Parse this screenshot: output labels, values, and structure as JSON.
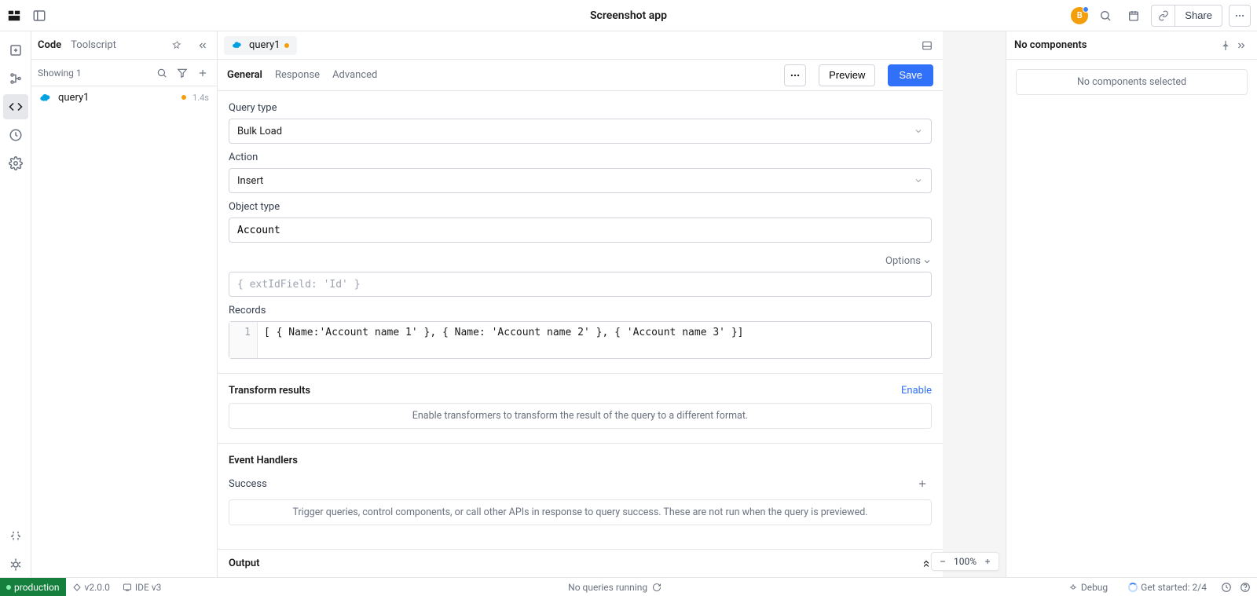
{
  "header": {
    "app_title": "Screenshot app",
    "avatar_initial": "B",
    "share_label": "Share"
  },
  "code_panel": {
    "tabs": {
      "code": "Code",
      "toolscript": "Toolscript"
    },
    "showing": "Showing 1",
    "queries": [
      {
        "name": "query1",
        "timing": "1.4s",
        "dirty": true
      }
    ]
  },
  "query_tab": {
    "name": "query1",
    "dirty": true
  },
  "config": {
    "tabs": {
      "general": "General",
      "response": "Response",
      "advanced": "Advanced"
    },
    "preview_label": "Preview",
    "save_label": "Save",
    "fields": {
      "query_type": {
        "label": "Query type",
        "value": "Bulk Load"
      },
      "action": {
        "label": "Action",
        "value": "Insert"
      },
      "object_type": {
        "label": "Object type",
        "value": "Account"
      },
      "options_label": "Options",
      "options_placeholder": "{ extIdField: 'Id' }",
      "records": {
        "label": "Records",
        "line_number": "1",
        "code": "[ { Name:'Account name 1' }, { Name: 'Account name 2' }, { 'Account name 3' }]"
      }
    },
    "transform": {
      "title": "Transform results",
      "enable": "Enable",
      "info": "Enable transformers to transform the result of the query to a different format."
    },
    "events": {
      "title": "Event Handlers",
      "success_label": "Success",
      "success_info": "Trigger queries, control components, or call other APIs in response to query success. These are not run when the query is previewed."
    },
    "output_label": "Output"
  },
  "right": {
    "title": "No components",
    "empty": "No components selected"
  },
  "zoom": {
    "value": "100%"
  },
  "status": {
    "env": "production",
    "version": "v2.0.0",
    "ide": "IDE v3",
    "center": "No queries running",
    "debug": "Debug",
    "started": "Get started: 2/4"
  }
}
